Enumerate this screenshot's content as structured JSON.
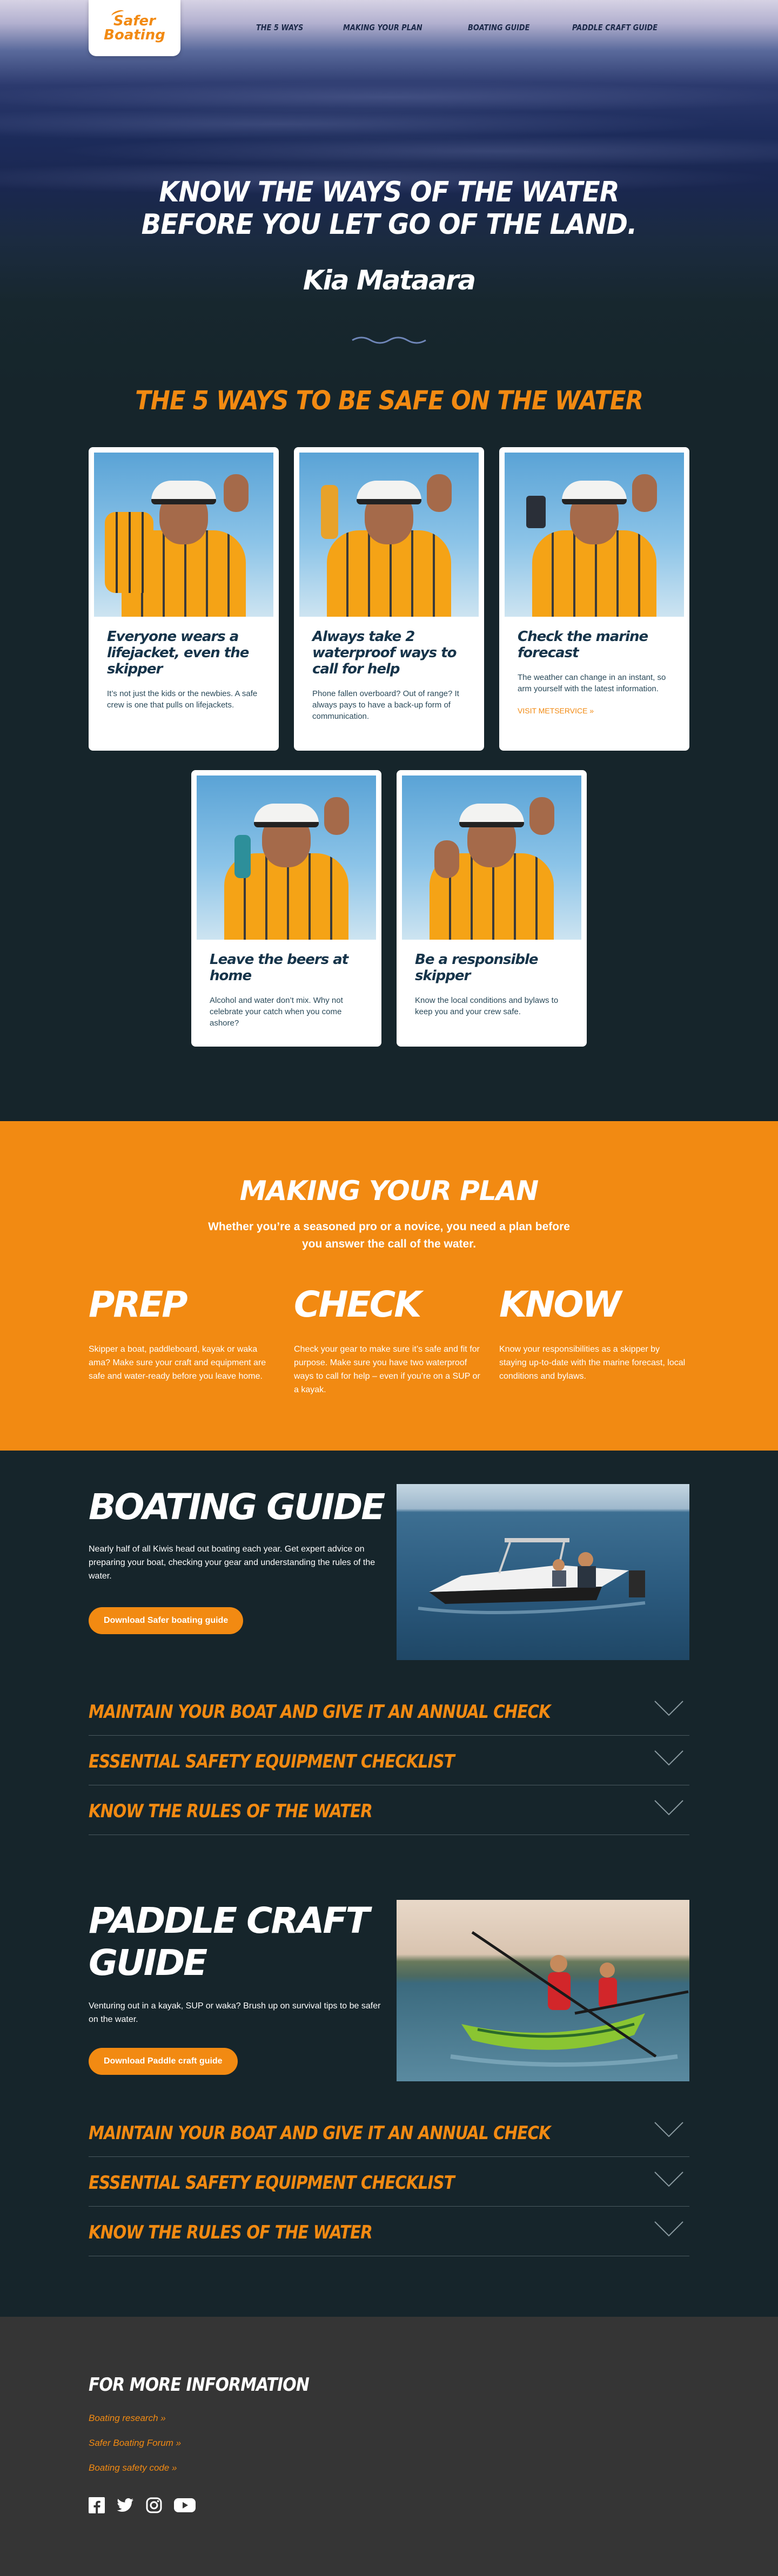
{
  "brand": {
    "logo_line1": "Safer",
    "logo_line2": "Boating"
  },
  "nav": {
    "items": [
      "THE 5 WAYS",
      "MAKING YOUR PLAN",
      "BOATING GUIDE",
      "PADDLE CRAFT GUIDE"
    ]
  },
  "hero": {
    "title_line1": "KNOW THE WAYS OF THE WATER",
    "title_line2": "BEFORE YOU LET GO OF THE LAND.",
    "tagline": "Kia Mataara"
  },
  "ways": {
    "title": "THE 5 WAYS TO BE SAFE ON THE WATER",
    "cards": [
      {
        "title": "Everyone wears a lifejacket, even the skipper",
        "text": "It’s not just the kids or the newbies. A safe crew is one that pulls on lifejackets."
      },
      {
        "title": "Always take 2 waterproof ways to call for help",
        "text": "Phone fallen overboard? Out of range? It always pays to have a back-up form of communication."
      },
      {
        "title": "Check the marine forecast",
        "text": "The weather can change in an instant, so arm yourself with the latest information.",
        "link": "VISIT METSERVICE »"
      },
      {
        "title": "Leave the beers at home",
        "text": "Alcohol and water don’t mix. Why not celebrate your catch when you come ashore?"
      },
      {
        "title": "Be a responsible skipper",
        "text": "Know the local conditions and bylaws to keep you and your crew safe."
      }
    ]
  },
  "plan": {
    "title": "MAKING YOUR PLAN",
    "subtitle": "Whether you’re a seasoned pro or a novice, you need a plan before you answer the call of the water.",
    "columns": [
      {
        "heading": "PREP",
        "text": "Skipper a boat, paddleboard, kayak or waka ama? Make sure your craft and equipment are safe and water-ready before you leave home."
      },
      {
        "heading": "CHECK",
        "text": "Check your gear to make sure it’s safe and fit for purpose. Make sure you have two waterproof ways to call for help – even if you’re on a SUP or a kayak."
      },
      {
        "heading": "KNOW",
        "text": "Know your responsibilities as a skipper by staying up-to-date with the marine forecast, local conditions and bylaws."
      }
    ]
  },
  "boating_guide": {
    "title": "BOATING GUIDE",
    "text": "Nearly half of all Kiwis head out boating each year. Get expert advice on preparing your boat, checking your gear and understanding the rules of the water.",
    "button": "Download Safer boating guide",
    "accordion": [
      "MAINTAIN YOUR BOAT AND GIVE IT AN ANNUAL CHECK",
      "ESSENTIAL SAFETY EQUIPMENT CHECKLIST",
      "KNOW THE RULES OF THE WATER"
    ]
  },
  "paddle_guide": {
    "title_line1": "PADDLE CRAFT",
    "title_line2": "GUIDE",
    "text": "Venturing out in a kayak, SUP or waka? Brush up on survival tips to be safer on the water.",
    "button": "Download Paddle craft guide",
    "accordion": [
      "MAINTAIN YOUR BOAT AND GIVE IT AN ANNUAL CHECK",
      "ESSENTIAL SAFETY EQUIPMENT CHECKLIST",
      "KNOW THE RULES OF THE WATER"
    ]
  },
  "footer": {
    "title": "FOR MORE INFORMATION",
    "links": [
      "Boating research »",
      "Safer Boating Forum »",
      "Boating safety code »"
    ],
    "social_icons": [
      "facebook-icon",
      "twitter-icon",
      "instagram-icon",
      "youtube-icon"
    ]
  },
  "colors": {
    "accent": "#f28a12",
    "dark": "#16252b",
    "footer": "#353535"
  }
}
